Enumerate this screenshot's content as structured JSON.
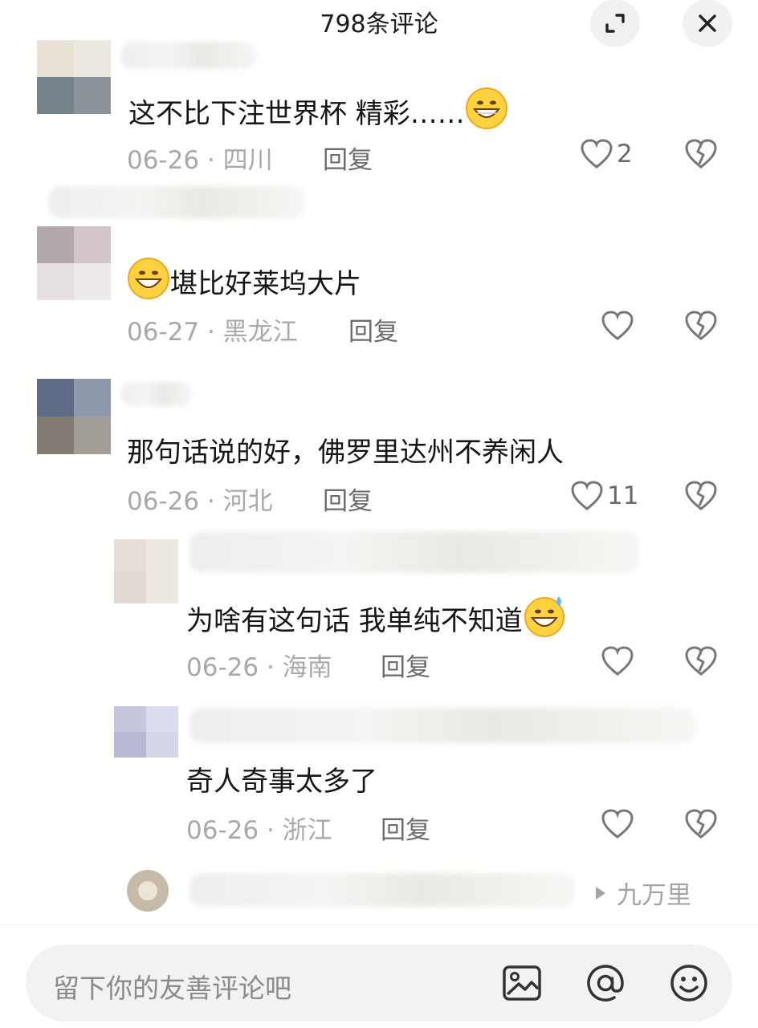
{
  "header": {
    "title": "798条评论",
    "expand_icon": "expand-icon",
    "close_icon": "close-icon"
  },
  "comments": [
    {
      "text": "这不比下注世界杯 精彩……",
      "date": "06-26",
      "region": "四川",
      "reply_label": "回复",
      "likes": "2",
      "emoji": "grinning-face-emoji",
      "emoji_position": "end"
    },
    {
      "text": "堪比好莱坞大片",
      "date": "06-27",
      "region": "黑龙江",
      "reply_label": "回复",
      "likes": "",
      "emoji": "grinning-face-emoji",
      "emoji_position": "start"
    },
    {
      "text": "那句话说的好，佛罗里达州不养闲人",
      "date": "06-26",
      "region": "河北",
      "reply_label": "回复",
      "likes": "11"
    }
  ],
  "replies": [
    {
      "text": "为啥有这句话  我单纯不知道",
      "date": "06-26",
      "region": "海南",
      "reply_label": "回复",
      "emoji": "sweat-grin-emoji"
    },
    {
      "text": "奇人奇事太多了",
      "date": "06-26",
      "region": "浙江",
      "reply_label": "回复"
    }
  ],
  "more_reply": {
    "link_label": "九万里"
  },
  "input_bar": {
    "placeholder": "留下你的友善评论吧",
    "image_icon": "image-icon",
    "mention_icon": "at-mention-icon",
    "emoji_icon": "emoji-icon"
  },
  "colors": {
    "background": "#fffffd",
    "text": "#161616",
    "meta": "#a9a9a9",
    "icon": "#7a7a7a",
    "input_bg": "#f2f2f0"
  }
}
